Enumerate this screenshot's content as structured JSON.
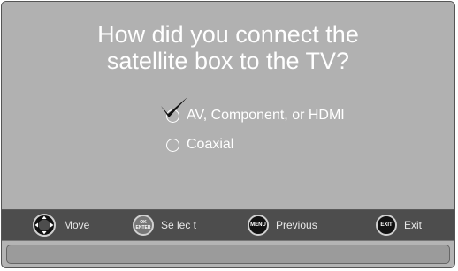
{
  "question": {
    "line1": "How did you connect the",
    "line2": "satellite box to the TV?"
  },
  "options": [
    {
      "label": "AV, Component, or HDMI",
      "selected": true
    },
    {
      "label": "Coaxial",
      "selected": false
    }
  ],
  "controls": {
    "move": {
      "label": "Move",
      "icon": "dpad-icon"
    },
    "select": {
      "label": "Se lec t",
      "icon": "ok-enter-icon",
      "button_top": "OK",
      "button_bottom": "ENTER"
    },
    "previous": {
      "label": "Previous",
      "icon": "menu-button-icon",
      "button_text": "MENU"
    },
    "exit": {
      "label": "Exit",
      "icon": "exit-button-icon",
      "button_text": "EXIT"
    }
  },
  "message": ""
}
